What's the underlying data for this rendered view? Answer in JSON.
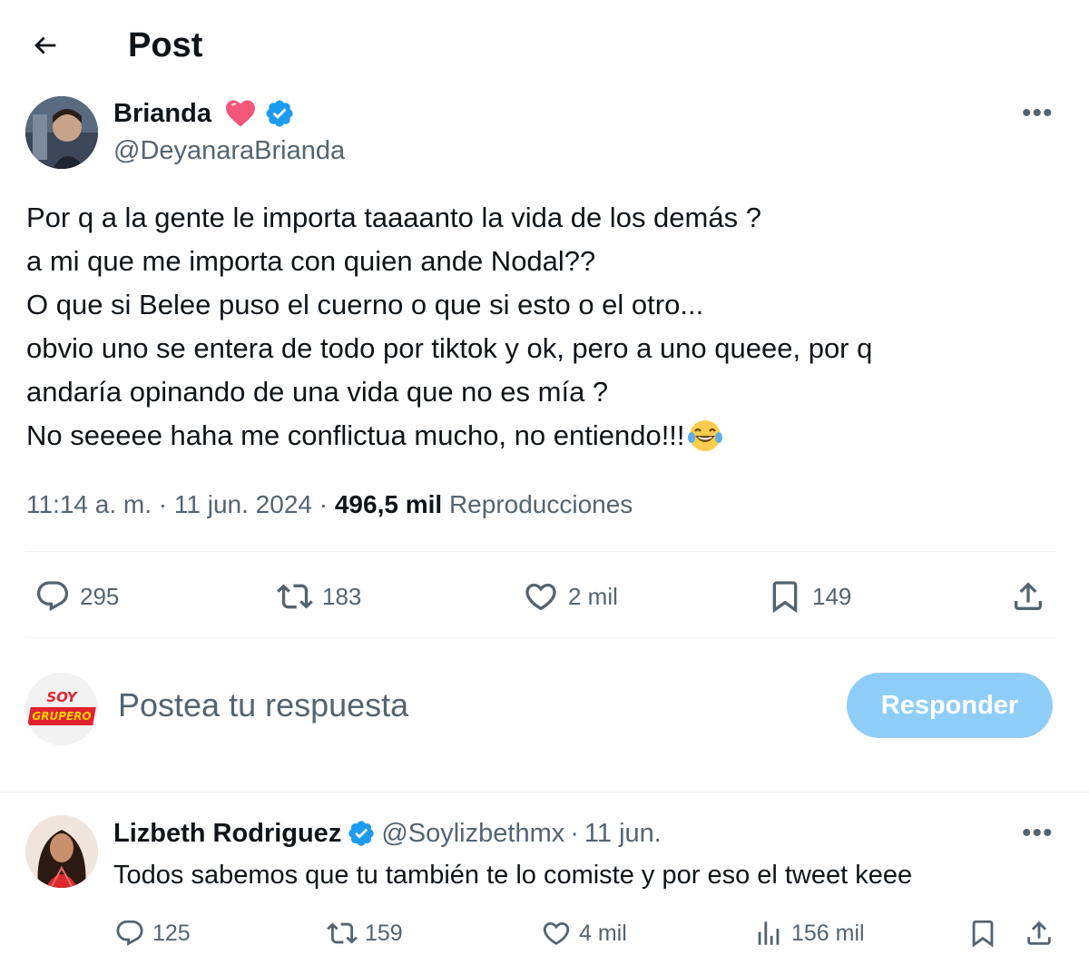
{
  "header": {
    "title": "Post"
  },
  "post": {
    "author_name": "Brianda",
    "author_handle": "@DeyanaraBrianda",
    "text_lines": [
      "Por q a la gente le importa taaaanto la vida de los demás ?",
      "a mi que me importa con quien ande Nodal??",
      "O que si Belee puso el cuerno o que si esto o el otro...",
      "obvio uno se entera de todo por tiktok y ok, pero a uno queee, por q",
      "andaría opinando de una vida que no es mía ?",
      "No seeeee haha me conflictua mucho, no entiendo!!!"
    ],
    "emoji": "😂",
    "time": "11:14 a. m.",
    "date": "11 jun. 2024",
    "views_count": "496,5 mil",
    "views_label": "Reproducciones",
    "stats": {
      "replies": "295",
      "reposts": "183",
      "likes": "2 mil",
      "bookmarks": "149"
    }
  },
  "composer": {
    "avatar_text_top": "SOY",
    "avatar_text_bottom": "GRUPERO",
    "placeholder": "Postea tu respuesta",
    "button_label": "Responder"
  },
  "reply": {
    "author_name": "Lizbeth Rodriguez",
    "author_handle": "@Soylizbethmx",
    "date": "11 jun.",
    "text": "Todos sabemos que tu también te lo comiste y por eso el tweet keee",
    "stats": {
      "replies": "125",
      "reposts": "159",
      "likes": "4 mil",
      "views": "156 mil"
    }
  },
  "colors": {
    "accent": "#1d9bf0",
    "button_disabled": "#8ecdf8",
    "muted": "#536471",
    "heart": "#f4577a"
  }
}
